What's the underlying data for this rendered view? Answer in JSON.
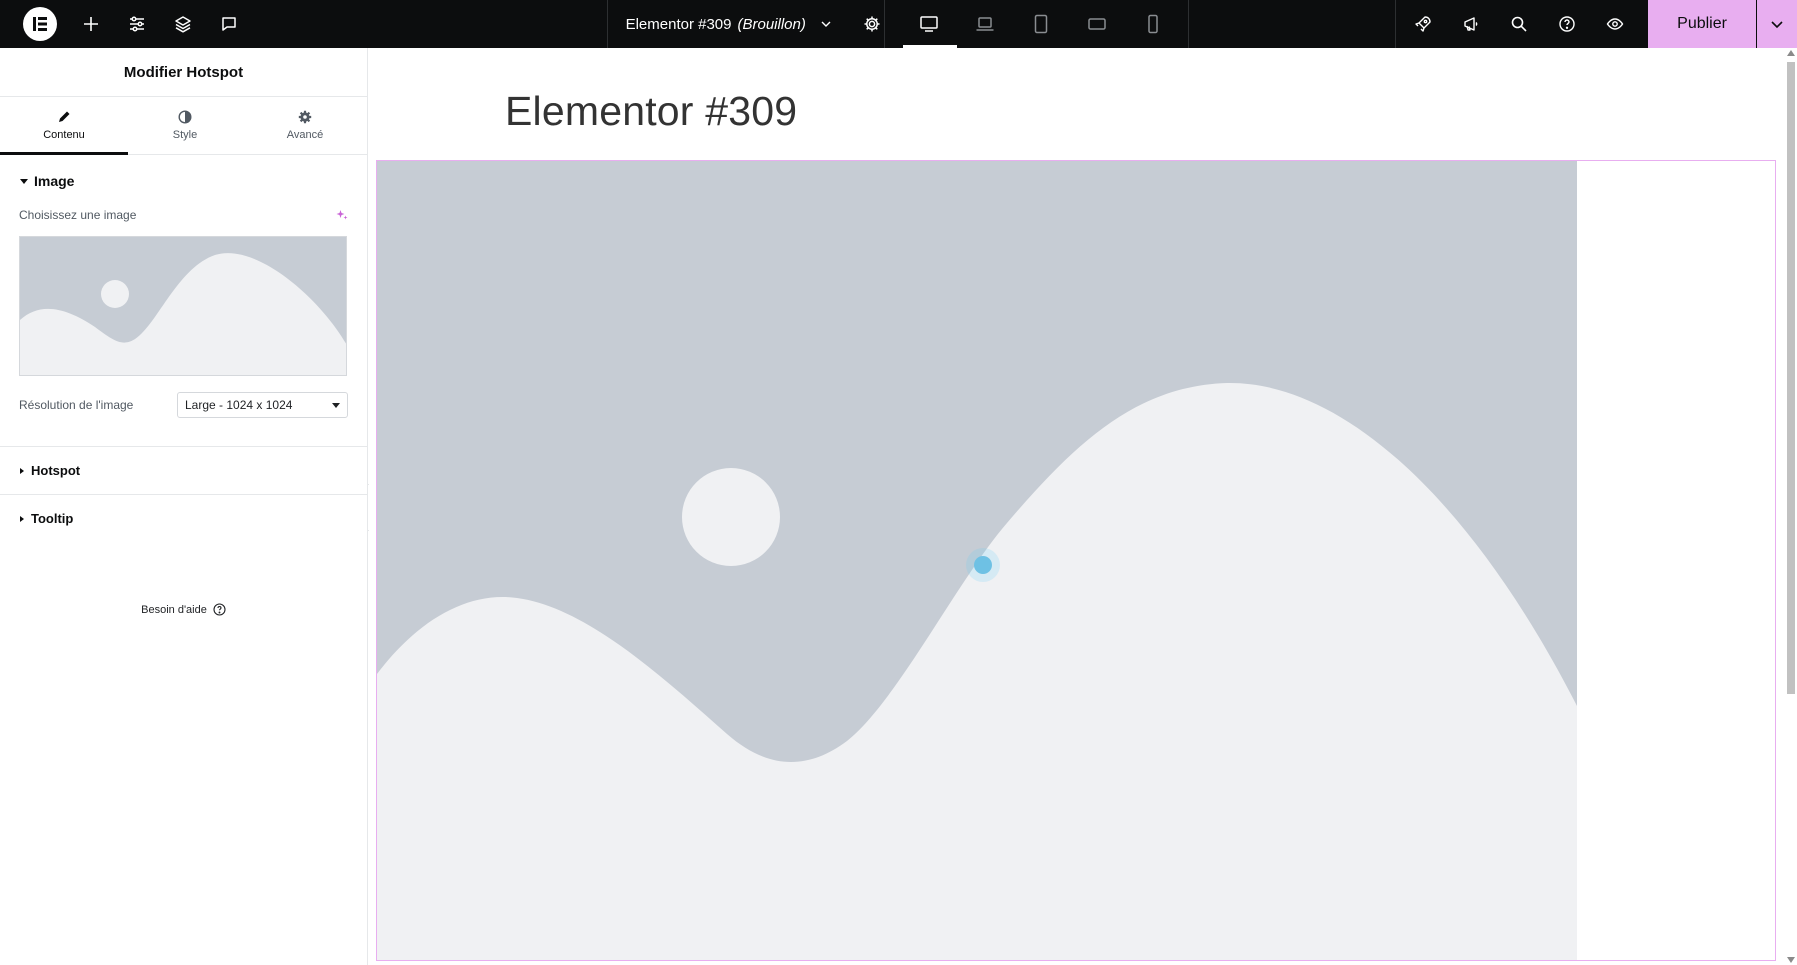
{
  "topbar": {
    "document_title": "Elementor #309",
    "document_status": "(Brouillon)",
    "publish_label": "Publier",
    "icons_left": [
      "elementor-logo-icon",
      "add-element-icon",
      "site-settings-icon",
      "structure-layers-icon",
      "notes-comments-icon"
    ],
    "devices": [
      "desktop-icon",
      "laptop-icon",
      "tablet-icon",
      "tablet-landscape-icon",
      "mobile-icon"
    ],
    "active_device": "desktop",
    "icons_right": [
      "launch-checklist-icon",
      "whats-new-icon",
      "search-icon",
      "help-icon",
      "preview-eye-icon"
    ]
  },
  "panel": {
    "title": "Modifier Hotspot",
    "tabs": [
      {
        "label": "Contenu",
        "icon": "pencil-icon",
        "active": true
      },
      {
        "label": "Style",
        "icon": "half-circle-icon",
        "active": false
      },
      {
        "label": "Avancé",
        "icon": "gear-icon",
        "active": false
      }
    ],
    "image_section": {
      "title": "Image",
      "choose_label": "Choisissez une image",
      "resolution_label": "Résolution de l'image",
      "resolution_value": "Large - 1024 x 1024"
    },
    "sections": [
      {
        "title": "Hotspot"
      },
      {
        "title": "Tooltip"
      }
    ],
    "help_label": "Besoin d'aide"
  },
  "canvas": {
    "page_title": "Elementor #309"
  },
  "colors": {
    "topbar_bg": "#0c0d0e",
    "publish_accent": "#e8aef0",
    "placeholder_sky": "#c6ccd4",
    "placeholder_fg": "#f0f1f3",
    "hotspot": "#6ec1e4"
  }
}
